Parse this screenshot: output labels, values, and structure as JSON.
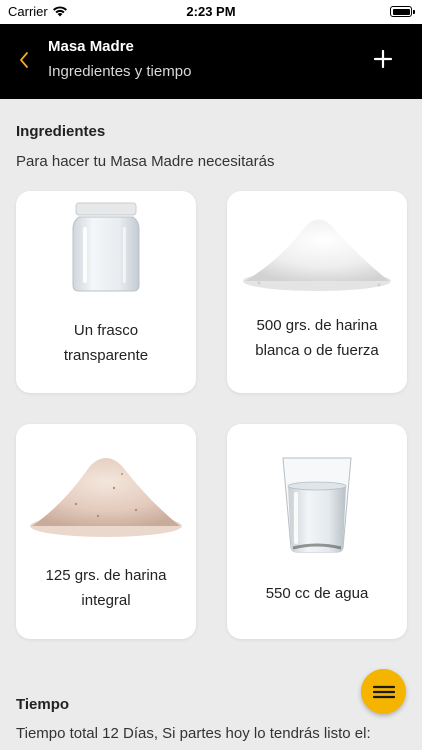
{
  "status_bar": {
    "carrier": "Carrier",
    "time": "2:23 PM"
  },
  "navbar": {
    "title": "Masa Madre",
    "subtitle": "Ingredientes y tiempo",
    "back_icon": "chevron-left-icon",
    "add_icon": "plus-icon"
  },
  "ingredients": {
    "heading": "Ingredientes",
    "intro": "Para hacer tu Masa Madre necesitarás",
    "items": [
      {
        "line1": "Un frasco",
        "line2": "transparente",
        "icon": "jar-icon"
      },
      {
        "line1": "500 grs. de harina",
        "line2": "blanca o de fuerza",
        "icon": "white-flour-icon"
      },
      {
        "line1": "125 grs. de harina",
        "line2": "integral",
        "icon": "wholewheat-flour-icon"
      },
      {
        "line1": "550 cc de agua",
        "line2": "",
        "icon": "water-glass-icon"
      }
    ]
  },
  "time": {
    "heading": "Tiempo",
    "text": "Tiempo total 12 Días, Si partes hoy lo tendrás listo el:"
  },
  "fab": {
    "icon": "menu-icon"
  },
  "colors": {
    "accent": "#f5b400",
    "navbar": "#000000",
    "background": "#ebebeb",
    "back_arrow": "#f5a623"
  }
}
